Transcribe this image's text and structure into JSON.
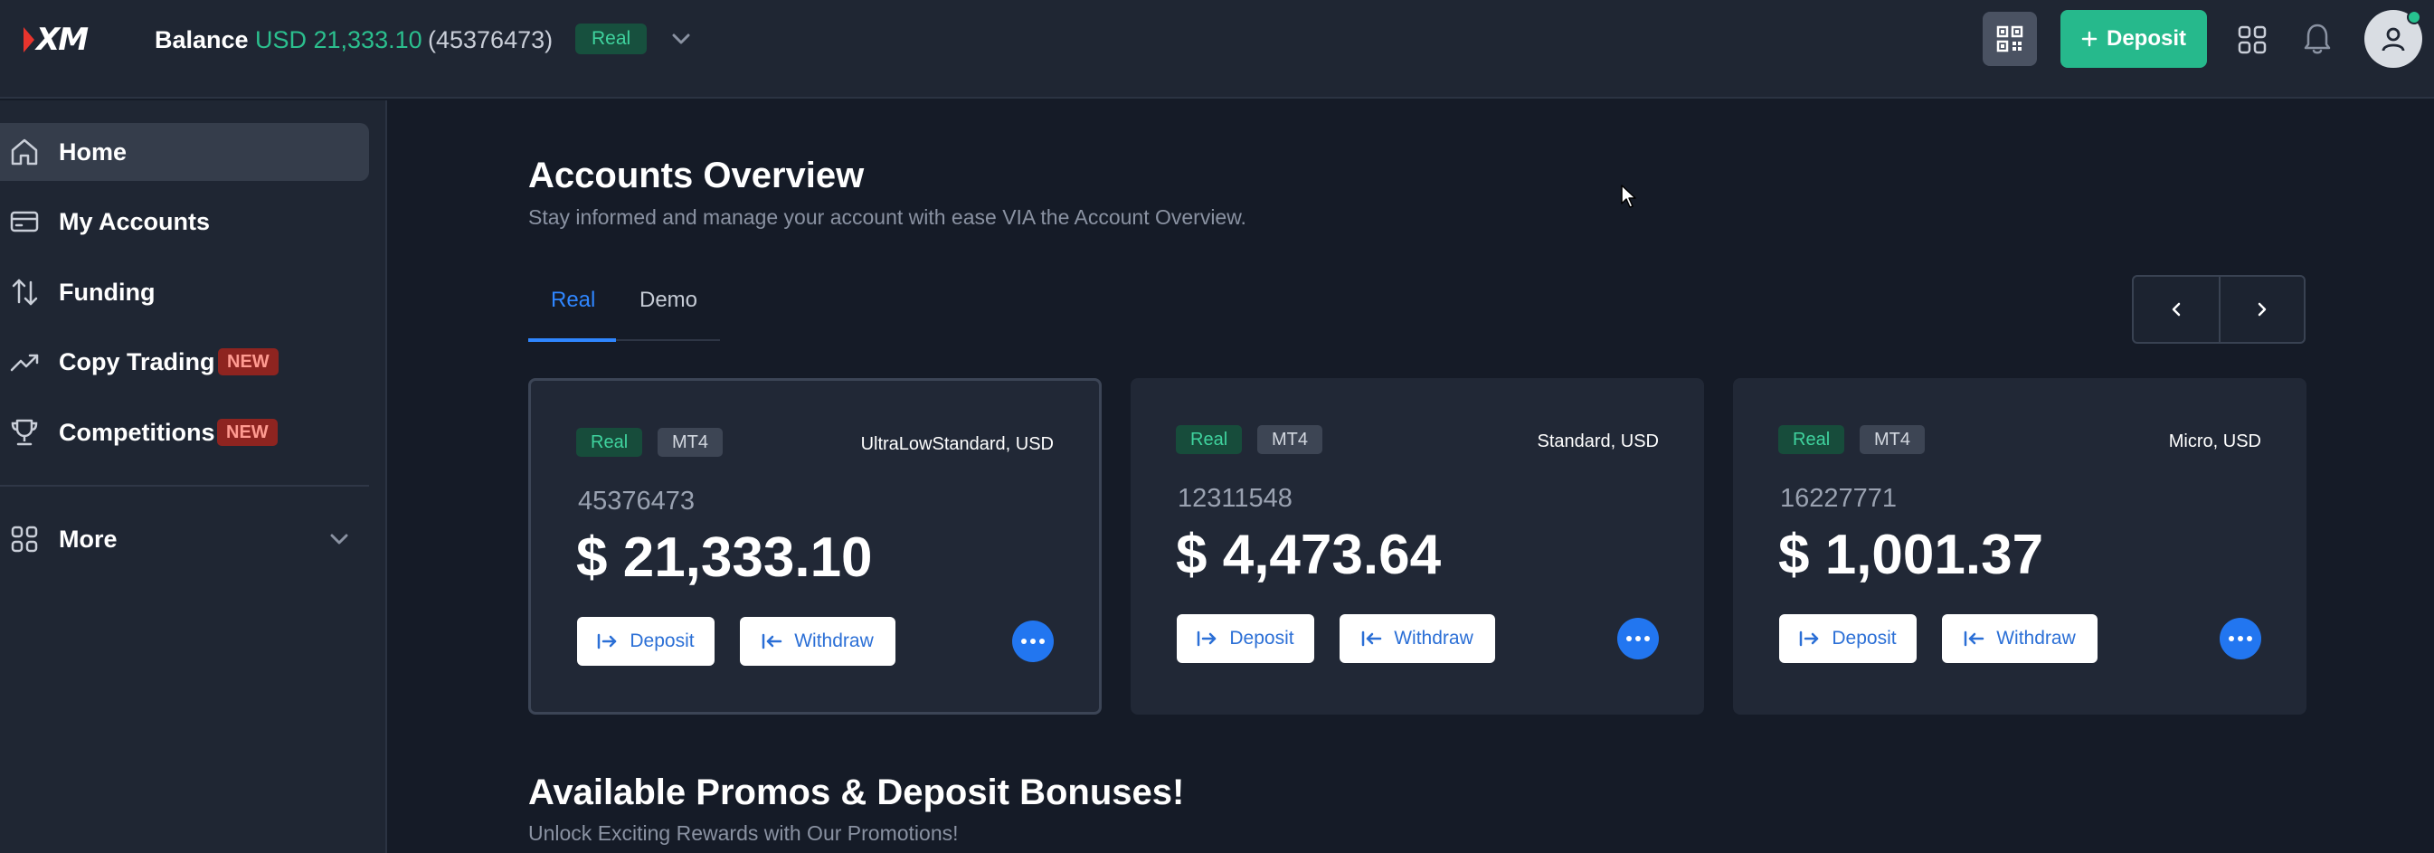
{
  "header": {
    "logo_text": "XM",
    "balance_label": "Balance",
    "balance_value": "USD 21,333.10",
    "account_id": "(45376473)",
    "account_type_badge": "Real",
    "deposit_label": "Deposit",
    "icons": [
      "qr-code-icon",
      "plus-icon",
      "apps-grid-icon",
      "bell-icon",
      "user-icon",
      "chevron-down-icon"
    ]
  },
  "sidebar": {
    "items": [
      {
        "label": "Home",
        "icon": "home-icon",
        "active": true
      },
      {
        "label": "My Accounts",
        "icon": "card-icon"
      },
      {
        "label": "Funding",
        "icon": "transfer-arrows-icon"
      },
      {
        "label": "Copy Trading",
        "icon": "trend-up-icon",
        "badge": "NEW"
      },
      {
        "label": "Competitions",
        "icon": "trophy-icon",
        "badge": "NEW"
      }
    ],
    "more_label": "More"
  },
  "main": {
    "title": "Accounts Overview",
    "subtitle": "Stay informed and manage your account with ease VIA the Account Overview.",
    "tabs": [
      {
        "label": "Real",
        "active": true
      },
      {
        "label": "Demo"
      }
    ],
    "accounts": [
      {
        "badge": "Real",
        "platform": "MT4",
        "type": "UltraLowStandard, USD",
        "number": "45376473",
        "amount": "$ 21,333.10",
        "deposit_label": "Deposit",
        "withdraw_label": "Withdraw"
      },
      {
        "badge": "Real",
        "platform": "MT4",
        "type": "Standard, USD",
        "number": "12311548",
        "amount": "$ 4,473.64",
        "deposit_label": "Deposit",
        "withdraw_label": "Withdraw"
      },
      {
        "badge": "Real",
        "platform": "MT4",
        "type": "Micro, USD",
        "number": "16227771",
        "amount": "$ 1,001.37",
        "deposit_label": "Deposit",
        "withdraw_label": "Withdraw"
      }
    ],
    "promos_title": "Available Promos & Deposit Bonuses!",
    "promos_subtitle": "Unlock Exciting Rewards with Our Promotions!"
  },
  "colors": {
    "accent_green": "#26b98c",
    "accent_blue": "#2f86ff",
    "badge_new_bg": "#8e2420",
    "background": "#151b27",
    "panel": "#1f2633"
  }
}
